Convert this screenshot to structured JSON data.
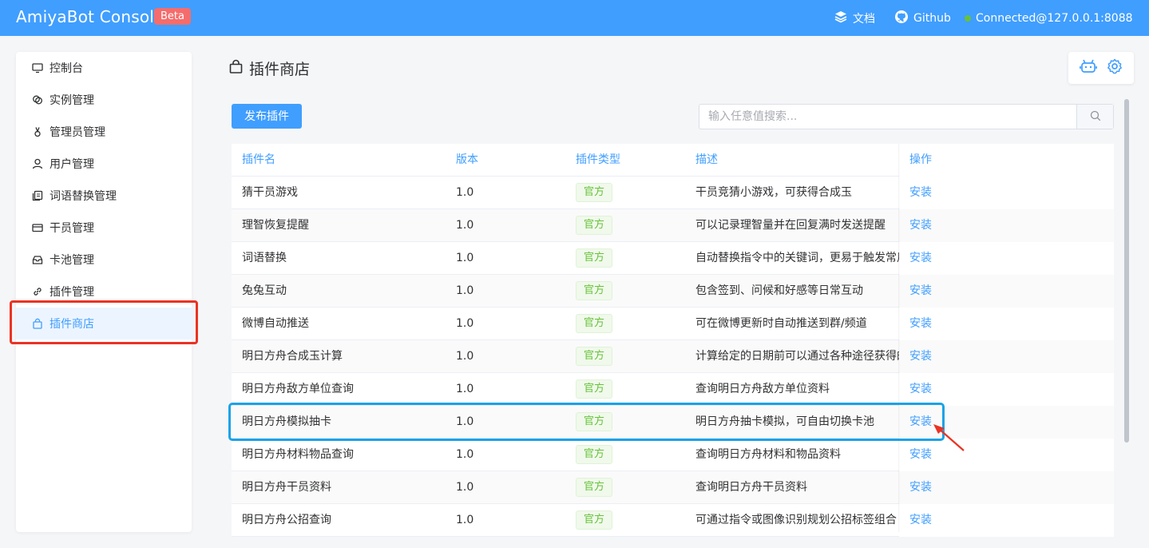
{
  "header": {
    "title": "AmiyaBot Console",
    "badge": "Beta",
    "docs": "文档",
    "github": "Github",
    "connection": "Connected@127.0.0.1:8088"
  },
  "sidebar": {
    "items": [
      {
        "label": "控制台",
        "icon": "monitor-icon"
      },
      {
        "label": "实例管理",
        "icon": "instances-icon"
      },
      {
        "label": "管理员管理",
        "icon": "admin-icon"
      },
      {
        "label": "用户管理",
        "icon": "user-icon"
      },
      {
        "label": "词语替换管理",
        "icon": "document-icon"
      },
      {
        "label": "干员管理",
        "icon": "card-icon"
      },
      {
        "label": "卡池管理",
        "icon": "pool-icon"
      },
      {
        "label": "插件管理",
        "icon": "link-icon"
      },
      {
        "label": "插件商店",
        "icon": "bag-icon",
        "active": true
      }
    ]
  },
  "page": {
    "title": "插件商店",
    "publish_button": "发布插件",
    "search_placeholder": "输入任意值搜索..."
  },
  "table": {
    "columns": [
      "插件名",
      "版本",
      "插件类型",
      "描述",
      "操作"
    ],
    "rows": [
      {
        "name": "猜干员游戏",
        "version": "1.0",
        "type": "官方",
        "desc": "干员竞猜小游戏，可获得合成玉",
        "op": "安装"
      },
      {
        "name": "理智恢复提醒",
        "version": "1.0",
        "type": "官方",
        "desc": "可以记录理智量并在回复满时发送提醒",
        "op": "安装"
      },
      {
        "name": "词语替换",
        "version": "1.0",
        "type": "官方",
        "desc": "自动替换指令中的关键词，更易于触发常用",
        "op": "安装"
      },
      {
        "name": "兔兔互动",
        "version": "1.0",
        "type": "官方",
        "desc": "包含签到、问候和好感等日常互动",
        "op": "安装"
      },
      {
        "name": "微博自动推送",
        "version": "1.0",
        "type": "官方",
        "desc": "可在微博更新时自动推送到群/频道",
        "op": "安装"
      },
      {
        "name": "明日方舟合成玉计算",
        "version": "1.0",
        "type": "官方",
        "desc": "计算给定的日期前可以通过各种途径获得的",
        "op": "安装"
      },
      {
        "name": "明日方舟敌方单位查询",
        "version": "1.0",
        "type": "官方",
        "desc": "查询明日方舟敌方单位资料",
        "op": "安装"
      },
      {
        "name": "明日方舟模拟抽卡",
        "version": "1.0",
        "type": "官方",
        "desc": "明日方舟抽卡模拟，可自由切换卡池",
        "op": "安装"
      },
      {
        "name": "明日方舟材料物品查询",
        "version": "1.0",
        "type": "官方",
        "desc": "查询明日方舟材料和物品资料",
        "op": "安装"
      },
      {
        "name": "明日方舟干员资料",
        "version": "1.0",
        "type": "官方",
        "desc": "查询明日方舟干员资料",
        "op": "安装"
      },
      {
        "name": "明日方舟公招查询",
        "version": "1.0",
        "type": "官方",
        "desc": "可通过指令或图像识别规划公招标签组合",
        "op": "安装"
      }
    ]
  },
  "colors": {
    "primary": "#409eff",
    "beta": "#f56c6c",
    "success": "#67c23a",
    "highlight_red": "#ea3323",
    "highlight_blue": "#1aa3e8"
  }
}
